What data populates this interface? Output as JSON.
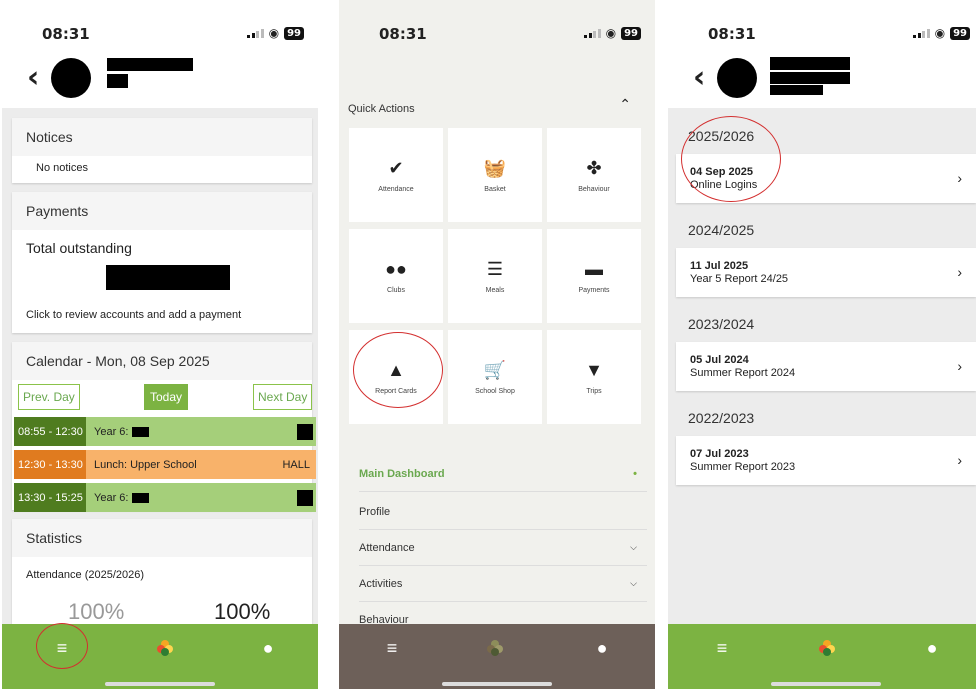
{
  "status": {
    "time": "08:31",
    "battery": "99"
  },
  "screen1": {
    "notices": {
      "title": "Notices",
      "empty": "No notices"
    },
    "payments": {
      "title": "Payments",
      "total_label": "Total outstanding",
      "hint": "Click to review accounts and add a payment"
    },
    "calendar": {
      "title": "Calendar - Mon, 08 Sep 2025",
      "prev": "Prev. Day",
      "today": "Today",
      "next": "Next Day",
      "events": [
        {
          "time": "08:55 - 12:30",
          "label": "Year 6:",
          "room": ""
        },
        {
          "time": "12:30 - 13:30",
          "label": "Lunch: Upper School",
          "room": "HALL"
        },
        {
          "time": "13:30 - 15:25",
          "label": "Year 6:",
          "room": ""
        }
      ]
    },
    "statistics": {
      "title": "Statistics",
      "attendance_label": "Attendance (2025/2026)",
      "value_a": "100%",
      "value_b": "100%"
    }
  },
  "screen2": {
    "quick_actions": "Quick Actions",
    "tiles": [
      {
        "label": "Attendance",
        "icon": "check-circle-icon"
      },
      {
        "label": "Basket",
        "icon": "basket-icon"
      },
      {
        "label": "Behaviour",
        "icon": "award-icon"
      },
      {
        "label": "Clubs",
        "icon": "users-icon"
      },
      {
        "label": "Meals",
        "icon": "menu-book-icon"
      },
      {
        "label": "Payments",
        "icon": "credit-card-icon"
      },
      {
        "label": "Report Cards",
        "icon": "person-icon"
      },
      {
        "label": "School Shop",
        "icon": "cart-icon"
      },
      {
        "label": "Trips",
        "icon": "map-pin-icon"
      }
    ],
    "menu": [
      {
        "label": "Main Dashboard"
      },
      {
        "label": "Profile"
      },
      {
        "label": "Attendance"
      },
      {
        "label": "Activities"
      },
      {
        "label": "Behaviour"
      }
    ]
  },
  "screen3": {
    "groups": [
      {
        "year": "2025/2026",
        "date": "04 Sep 2025",
        "name": "Online Logins"
      },
      {
        "year": "2024/2025",
        "date": "11 Jul 2025",
        "name": "Year 5 Report 24/25"
      },
      {
        "year": "2023/2024",
        "date": "05 Jul 2024",
        "name": "Summer Report 2024"
      },
      {
        "year": "2022/2023",
        "date": "07 Jul 2023",
        "name": "Summer Report 2023"
      }
    ]
  },
  "colors": {
    "green": "#7cb342",
    "dark_green": "#4f7c1f",
    "light_green": "#a5cf7a",
    "orange": "#f8b26a",
    "tabbar_dim": "#6d6059",
    "red_circle": "#d32f2f"
  }
}
